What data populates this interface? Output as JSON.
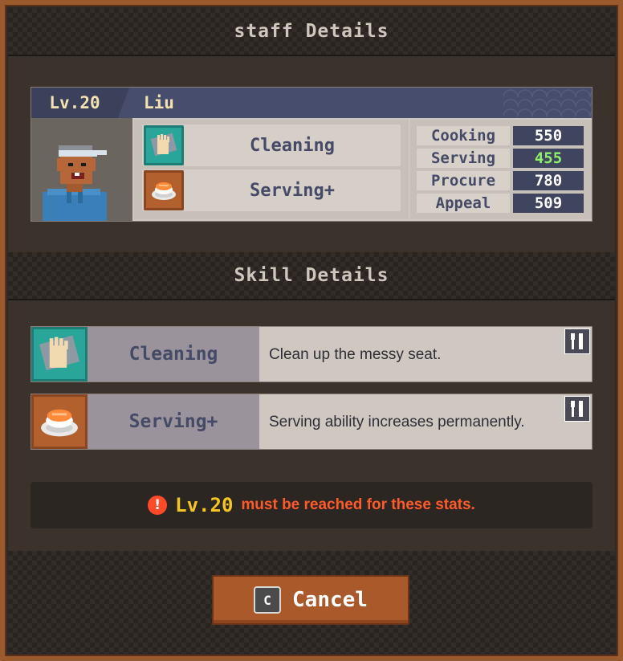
{
  "dialog": {
    "title": "staff Details"
  },
  "staff": {
    "level": "Lv.20",
    "name": "Liu",
    "skills": [
      {
        "label": "Cleaning",
        "icon": "cleaning-glove-icon"
      },
      {
        "label": "Serving+",
        "icon": "sushi-plate-icon"
      }
    ],
    "stats": [
      {
        "name": "Cooking",
        "value": "550",
        "highlight": false
      },
      {
        "name": "Serving",
        "value": "455",
        "highlight": true
      },
      {
        "name": "Procure",
        "value": "780",
        "highlight": false
      },
      {
        "name": "Appeal",
        "value": "509",
        "highlight": false
      }
    ]
  },
  "skill_details": {
    "title": "Skill Details",
    "items": [
      {
        "name": "Cleaning",
        "description": "Clean up the messy seat.",
        "icon": "cleaning-glove-icon",
        "badge": "utensils-icon"
      },
      {
        "name": "Serving+",
        "description": "Serving ability increases permanently.",
        "icon": "sushi-plate-icon",
        "badge": "utensils-icon"
      }
    ]
  },
  "requirement": {
    "level": "Lv.20",
    "text": "must be reached for these stats."
  },
  "footer": {
    "key": "C",
    "cancel_label": "Cancel"
  },
  "colors": {
    "frame": "#9a5a2e",
    "teal_icon_bg": "#2aa59a",
    "orange_icon_bg": "#b2612e",
    "highlight_stat": "#8ef06b",
    "warning_red": "#ff5a2a",
    "warning_level": "#f5c623"
  }
}
